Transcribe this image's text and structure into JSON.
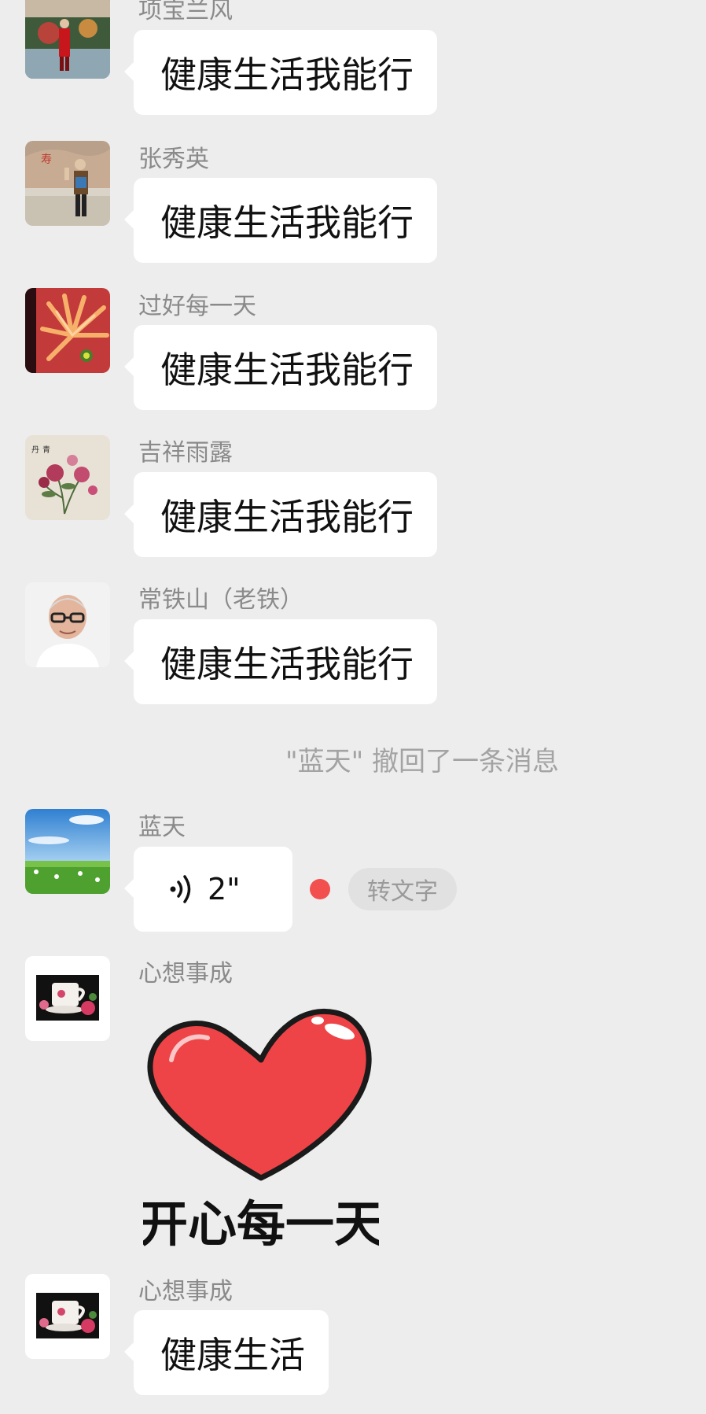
{
  "messages": [
    {
      "sender": "项宝兰风",
      "text": "健康生活我能行",
      "avatar": "person-red-coat-avatar"
    },
    {
      "sender": "张秀英",
      "text": "健康生活我能行",
      "avatar": "person-by-rock-avatar"
    },
    {
      "sender": "过好每一天",
      "text": "健康生活我能行",
      "avatar": "flower-closeup-avatar"
    },
    {
      "sender": "吉祥雨露",
      "text": "健康生活我能行",
      "avatar": "peony-painting-avatar"
    },
    {
      "sender": "常铁山（老铁）",
      "text": "健康生活我能行",
      "avatar": "man-glasses-avatar"
    }
  ],
  "system_notice": "\"蓝天\" 撤回了一条消息",
  "voice_message": {
    "sender": "蓝天",
    "duration": "2\"",
    "transcribe_label": "转文字",
    "avatar": "sky-meadow-avatar",
    "unread_color": "#f2504f"
  },
  "sticker_message": {
    "sender": "心想事成",
    "caption": "开心每一天",
    "avatar": "tea-cup-flowers-avatar",
    "heart_color": "#ee4447"
  },
  "last_message": {
    "sender": "心想事成",
    "text": "健康生活",
    "avatar": "tea-cup-flowers-avatar"
  },
  "colors": {
    "background": "#ededed",
    "bubble": "#ffffff",
    "sender_name": "#8a8a8a"
  }
}
